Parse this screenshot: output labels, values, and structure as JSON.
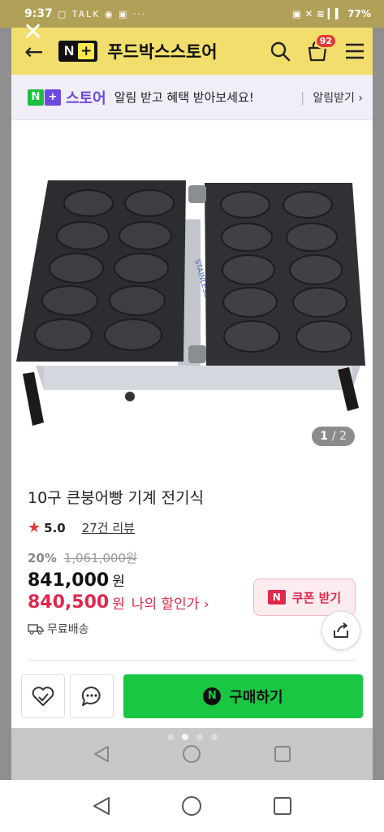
{
  "status_bar": {
    "time": "9:37",
    "notif_icons": "▢ TALK ◉ ▣ ···",
    "right_icons": "▣ ✕ ≋ ▎▍",
    "battery": "77%"
  },
  "header": {
    "logo_n": "N",
    "logo_plus": "+",
    "store_name": "푸드박스스토어",
    "cart_count": "92"
  },
  "banner": {
    "logo_n": "N",
    "logo_plus": "+",
    "store_word": "스토어",
    "message": "알림 받고 혜택 받아보세요!",
    "separator": "|",
    "cta": "알림받기 ›"
  },
  "gallery": {
    "current": "1",
    "total": "/ 2",
    "stainless_label": "STAINLESS"
  },
  "product": {
    "title": "10구 큰붕어빵 기계 전기식",
    "rating": "5.0",
    "reviews": "27건 리뷰",
    "discount_pct": "20%",
    "original_price": "1,061,000원",
    "price": "841,000",
    "price_unit": "원",
    "my_price": "840,500",
    "my_price_unit": "원",
    "my_price_label": "나의 할인가 ›",
    "shipping": "무료배송"
  },
  "coupon": {
    "icon_letter": "N",
    "label": "쿠폰 받기"
  },
  "action_bar": {
    "buy_icon_letter": "N",
    "buy_label": "구매하기"
  },
  "colors": {
    "header_bg": "#f2de6c",
    "naver_green": "#19c742",
    "sale_red": "#e0284c",
    "store_purple": "#6d48e0"
  },
  "icons": [
    "back-arrow-icon",
    "close-icon",
    "search-icon",
    "cart-icon",
    "menu-icon",
    "star-icon",
    "truck-icon",
    "share-icon",
    "heart-icon",
    "chat-icon",
    "nav-back-icon",
    "nav-home-icon",
    "nav-recents-icon"
  ]
}
